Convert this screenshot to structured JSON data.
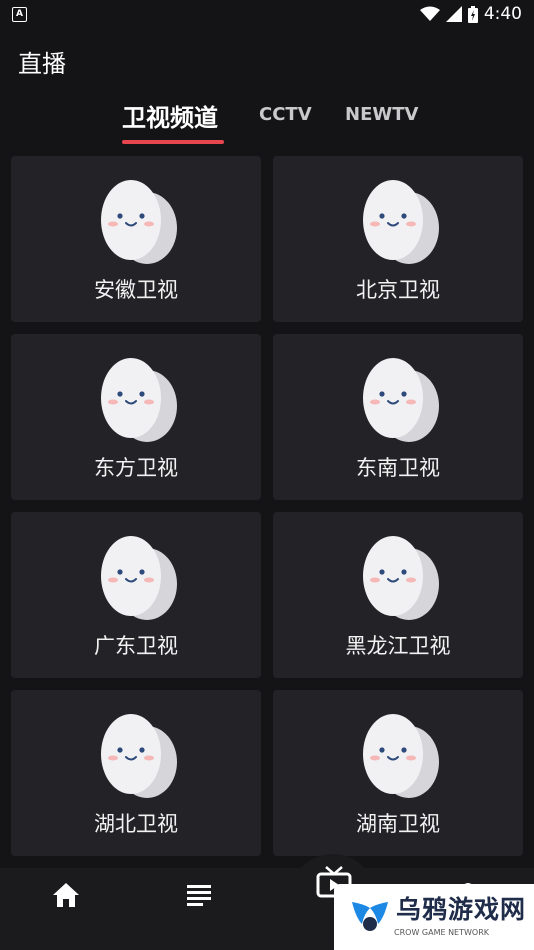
{
  "status_bar": {
    "notification_glyph": "A",
    "time": "4:40"
  },
  "header": {
    "title": "直播"
  },
  "tabs": [
    {
      "label": "卫视频道",
      "active": true
    },
    {
      "label": "CCTV",
      "active": false
    },
    {
      "label": "NEWTV",
      "active": false
    }
  ],
  "channels": [
    {
      "name": "安徽卫视"
    },
    {
      "name": "北京卫视"
    },
    {
      "name": "东方卫视"
    },
    {
      "name": "东南卫视"
    },
    {
      "name": "广东卫视"
    },
    {
      "name": "黑龙江卫视"
    },
    {
      "name": "湖北卫视"
    },
    {
      "name": "湖南卫视"
    }
  ],
  "bottom_nav": [
    {
      "icon": "home-icon"
    },
    {
      "icon": "list-icon"
    },
    {
      "icon": "tv-icon"
    },
    {
      "icon": "user-icon"
    }
  ],
  "watermark": {
    "title": "乌鸦游戏网",
    "subtitle": "CROW GAME NETWORK"
  },
  "colors": {
    "background": "#141417",
    "card": "#232327",
    "accent": "#e8464f"
  }
}
